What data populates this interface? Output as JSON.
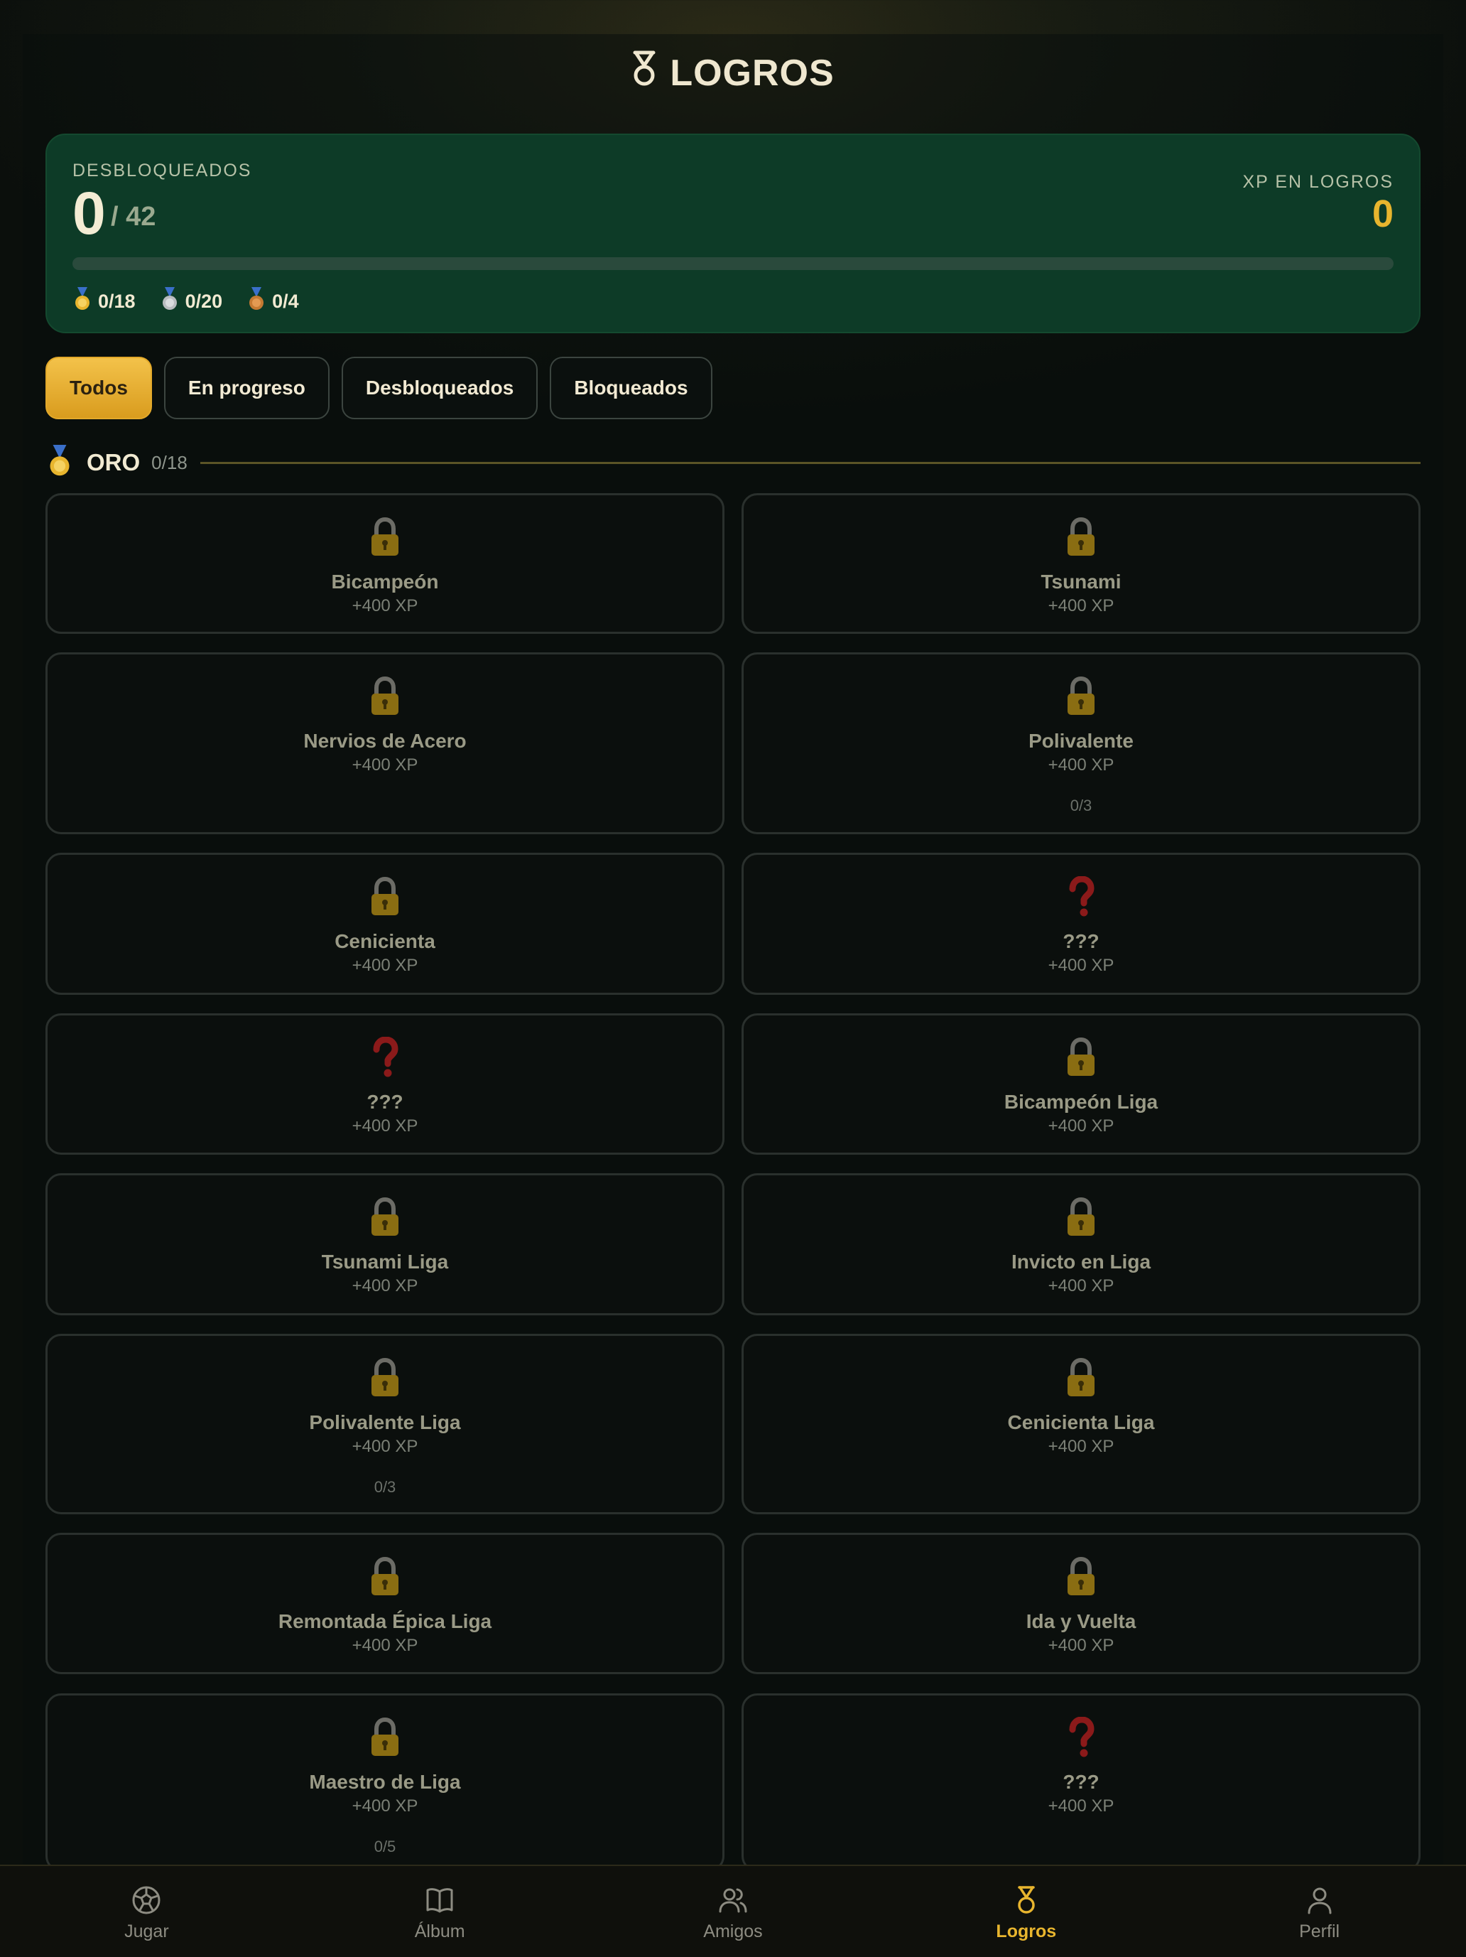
{
  "header": {
    "title": "LOGROS"
  },
  "stats": {
    "unlocked_label": "DESBLOQUEADOS",
    "unlocked_count": "0",
    "unlocked_total": "/ 42",
    "xp_label": "XP EN LOGROS",
    "xp_value": "0",
    "progress_fraction": 0,
    "tiers": [
      {
        "icon": "gold-medal-icon",
        "value": "0/18"
      },
      {
        "icon": "silver-medal-icon",
        "value": "0/20"
      },
      {
        "icon": "bronze-medal-icon",
        "value": "0/4"
      }
    ]
  },
  "tabs": [
    {
      "label": "Todos",
      "active": true
    },
    {
      "label": "En progreso",
      "active": false
    },
    {
      "label": "Desbloqueados",
      "active": false
    },
    {
      "label": "Bloqueados",
      "active": false
    }
  ],
  "section": {
    "name": "ORO",
    "count": "0/18",
    "icon": "gold-medal-icon"
  },
  "achievements": [
    {
      "icon": "lock-icon",
      "title": "Bicampeón",
      "xp": "+400 XP",
      "progress": ""
    },
    {
      "icon": "lock-icon",
      "title": "Tsunami",
      "xp": "+400 XP",
      "progress": ""
    },
    {
      "icon": "lock-icon",
      "title": "Nervios de Acero",
      "xp": "+400 XP",
      "progress": ""
    },
    {
      "icon": "lock-icon",
      "title": "Polivalente",
      "xp": "+400 XP",
      "progress": "0/3"
    },
    {
      "icon": "lock-icon",
      "title": "Cenicienta",
      "xp": "+400 XP",
      "progress": ""
    },
    {
      "icon": "question-icon",
      "title": "???",
      "xp": "+400 XP",
      "progress": ""
    },
    {
      "icon": "question-icon",
      "title": "???",
      "xp": "+400 XP",
      "progress": ""
    },
    {
      "icon": "lock-icon",
      "title": "Bicampeón Liga",
      "xp": "+400 XP",
      "progress": ""
    },
    {
      "icon": "lock-icon",
      "title": "Tsunami Liga",
      "xp": "+400 XP",
      "progress": ""
    },
    {
      "icon": "lock-icon",
      "title": "Invicto en Liga",
      "xp": "+400 XP",
      "progress": ""
    },
    {
      "icon": "lock-icon",
      "title": "Polivalente Liga",
      "xp": "+400 XP",
      "progress": "0/3"
    },
    {
      "icon": "lock-icon",
      "title": "Cenicienta Liga",
      "xp": "+400 XP",
      "progress": ""
    },
    {
      "icon": "lock-icon",
      "title": "Remontada Épica Liga",
      "xp": "+400 XP",
      "progress": ""
    },
    {
      "icon": "lock-icon",
      "title": "Ida y Vuelta",
      "xp": "+400 XP",
      "progress": ""
    },
    {
      "icon": "lock-icon",
      "title": "Maestro de Liga",
      "xp": "+400 XP",
      "progress": "0/5"
    },
    {
      "icon": "question-icon",
      "title": "???",
      "xp": "+400 XP",
      "progress": ""
    }
  ],
  "nav": [
    {
      "label": "Jugar",
      "icon": "soccer-ball-icon",
      "active": false
    },
    {
      "label": "Álbum",
      "icon": "book-icon",
      "active": false
    },
    {
      "label": "Amigos",
      "icon": "users-icon",
      "active": false
    },
    {
      "label": "Logros",
      "icon": "medal-icon",
      "active": true
    },
    {
      "label": "Perfil",
      "icon": "user-icon",
      "active": false
    }
  ],
  "colors": {
    "accent": "#e8b52e",
    "card_bg": "#0d3b27",
    "lock": "#8a6d12",
    "question": "#8b1a1a"
  }
}
